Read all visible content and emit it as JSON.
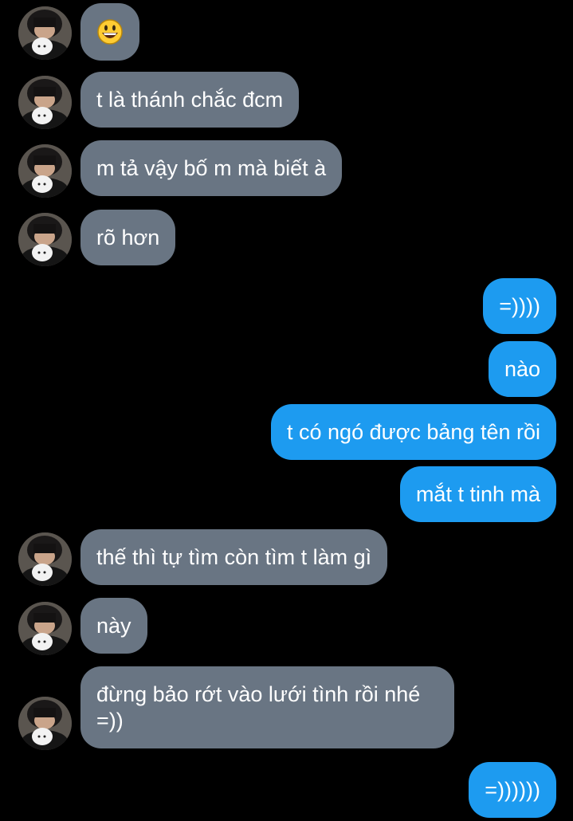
{
  "conversation": {
    "messages": [
      {
        "side": "in",
        "text": "😃",
        "avatar": "avatar"
      },
      {
        "side": "in",
        "text": "t là thánh chắc đcm",
        "avatar": "avatar"
      },
      {
        "side": "in",
        "text": "m tả vậy bố m mà biết à",
        "avatar": "avatar"
      },
      {
        "side": "in",
        "text": "rõ hơn",
        "avatar": "avatar"
      },
      {
        "side": "out",
        "text": "=))))"
      },
      {
        "side": "out",
        "text": "nào"
      },
      {
        "side": "out",
        "text": "t có ngó được bảng tên rồi"
      },
      {
        "side": "out",
        "text": "mắt t tinh mà"
      },
      {
        "side": "in",
        "text": "thế thì tự tìm còn tìm t làm gì",
        "avatar": "avatar"
      },
      {
        "side": "in",
        "text": "này",
        "avatar": "avatar"
      },
      {
        "side": "in",
        "text": "đừng bảo rớt vào lưới tình rồi nhé =))",
        "avatar": "avatar"
      },
      {
        "side": "out",
        "text": "=))))))"
      }
    ]
  },
  "colors": {
    "background": "#000000",
    "incoming_bubble": "#697583",
    "outgoing_bubble": "#1d9bf0",
    "text": "#ffffff"
  },
  "icons": {
    "avatar": "profile-photo",
    "emoji": "grinning-face-emoji"
  }
}
